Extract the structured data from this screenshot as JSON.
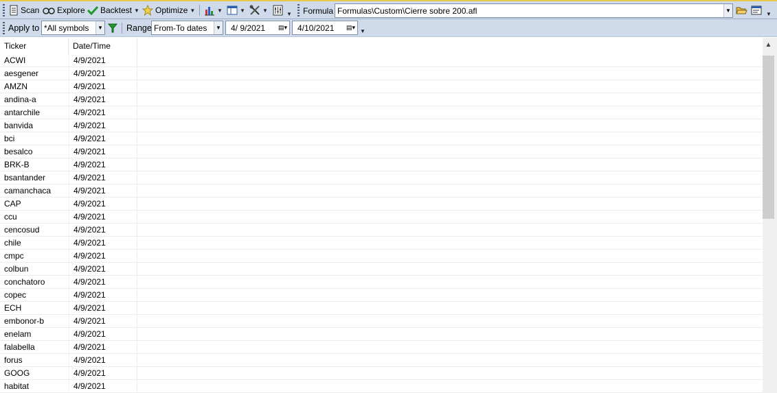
{
  "toolbar": {
    "scan": "Scan",
    "explore": "Explore",
    "backtest": "Backtest",
    "optimize": "Optimize",
    "formula_label": "Formula",
    "formula_path": "Formulas\\Custom\\Cierre sobre 200.afl"
  },
  "filters": {
    "apply_to_label": "Apply to",
    "apply_to_value": "*All symbols",
    "range_label": "Range",
    "range_value": "From-To dates",
    "from_date": "4/  9/2021",
    "to_date": "4/10/2021"
  },
  "grid": {
    "columns": [
      "Ticker",
      "Date/Time"
    ],
    "rows": [
      [
        "ACWI",
        "4/9/2021"
      ],
      [
        "aesgener",
        "4/9/2021"
      ],
      [
        "AMZN",
        "4/9/2021"
      ],
      [
        "andina-a",
        "4/9/2021"
      ],
      [
        "antarchile",
        "4/9/2021"
      ],
      [
        "banvida",
        "4/9/2021"
      ],
      [
        "bci",
        "4/9/2021"
      ],
      [
        "besalco",
        "4/9/2021"
      ],
      [
        "BRK-B",
        "4/9/2021"
      ],
      [
        "bsantander",
        "4/9/2021"
      ],
      [
        "camanchaca",
        "4/9/2021"
      ],
      [
        "CAP",
        "4/9/2021"
      ],
      [
        "ccu",
        "4/9/2021"
      ],
      [
        "cencosud",
        "4/9/2021"
      ],
      [
        "chile",
        "4/9/2021"
      ],
      [
        "cmpc",
        "4/9/2021"
      ],
      [
        "colbun",
        "4/9/2021"
      ],
      [
        "conchatoro",
        "4/9/2021"
      ],
      [
        "copec",
        "4/9/2021"
      ],
      [
        "ECH",
        "4/9/2021"
      ],
      [
        "embonor-b",
        "4/9/2021"
      ],
      [
        "enelam",
        "4/9/2021"
      ],
      [
        "falabella",
        "4/9/2021"
      ],
      [
        "forus",
        "4/9/2021"
      ],
      [
        "GOOG",
        "4/9/2021"
      ],
      [
        "habitat",
        "4/9/2021"
      ]
    ]
  },
  "colors": {
    "toolbar_bg": "#cfdbea",
    "accent": "#e8c84a"
  }
}
